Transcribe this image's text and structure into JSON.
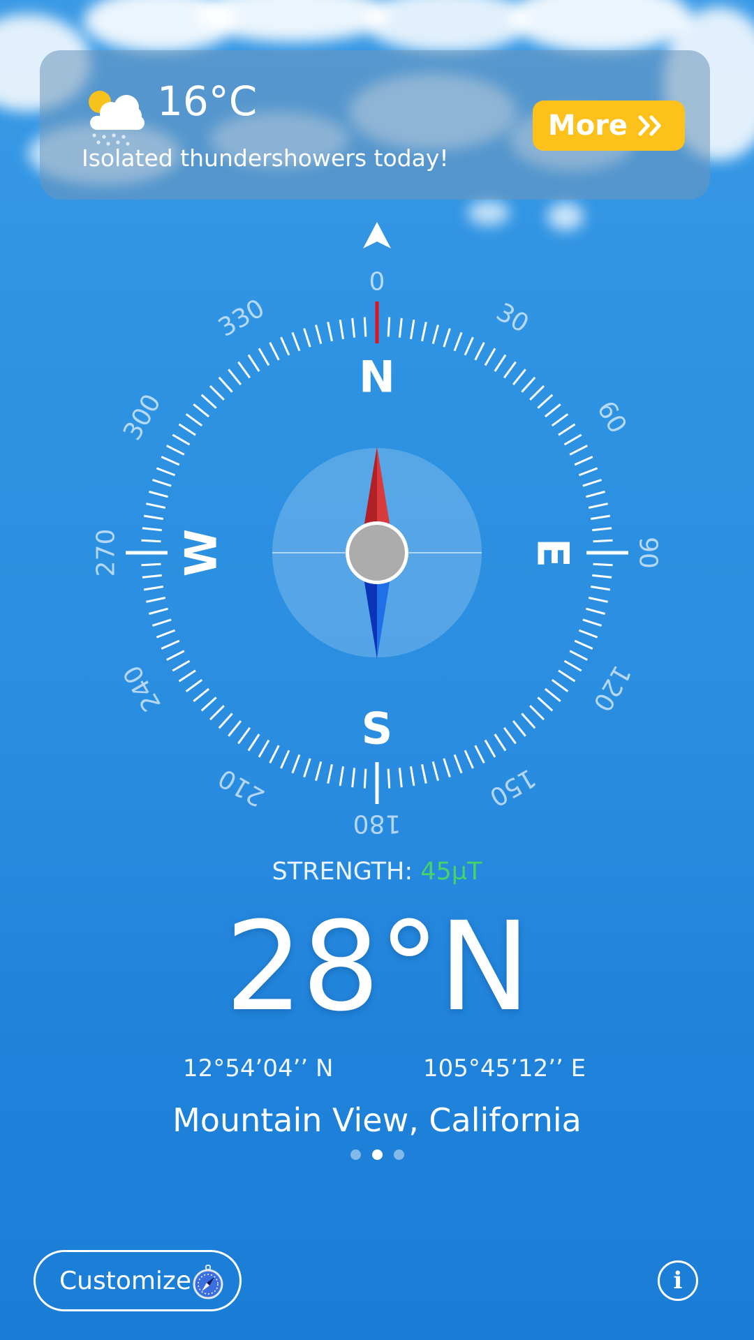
{
  "weather": {
    "icon": "partly-cloudy-rain-icon",
    "temperature": "16°C",
    "description": "Isolated thundershowers today!",
    "more_label": "More",
    "more_icon": "double-chevron-right-icon",
    "more_color": "#fcc11b"
  },
  "compass": {
    "cardinals": {
      "north": "N",
      "east": "E",
      "south": "S",
      "west": "W"
    },
    "degree_labels": [
      "0",
      "30",
      "60",
      "90",
      "120",
      "150",
      "180",
      "210",
      "240",
      "270",
      "300",
      "330"
    ],
    "north_tick_color": "#e3121c",
    "needle_north_color": "#d3282c",
    "needle_south_color": "#0a4fd0"
  },
  "strength": {
    "label": "STRENGTH:",
    "value": "45µT",
    "value_color": "#46d46a"
  },
  "heading": "28°N",
  "coordinates": {
    "latitude": "12°54’04’’ N",
    "longitude": "105°45’12’’ E"
  },
  "location": "Mountain View, California",
  "pager": {
    "count": 3,
    "active": 1
  },
  "footer": {
    "customize_label": "Customize",
    "customize_icon": "compass-icon",
    "info_icon": "info-icon"
  }
}
